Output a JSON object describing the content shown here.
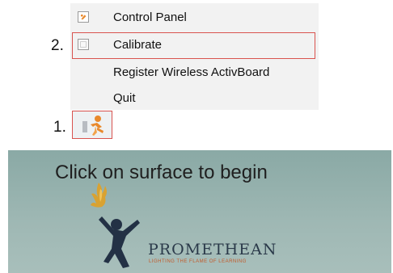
{
  "menu": {
    "items": [
      {
        "label": "Control Panel",
        "icon": "control-panel-icon"
      },
      {
        "label": "Calibrate",
        "icon": "calibrate-icon"
      },
      {
        "label": "Register Wireless ActivBoard"
      },
      {
        "label": "Quit"
      }
    ]
  },
  "steps": {
    "step1": "1.",
    "step2": "2."
  },
  "tray": {
    "icon": "promethean-tray-icon"
  },
  "calibration": {
    "prompt": "Click on surface to begin",
    "brand": "PROMETHEAN",
    "tagline": "LIGHTING THE FLAME OF LEARNING"
  },
  "colors": {
    "highlight": "#d9534f",
    "menu_bg": "#f2f2f2",
    "calibration_bg": "#9fb8b4",
    "brand_orange": "#e9892c"
  }
}
